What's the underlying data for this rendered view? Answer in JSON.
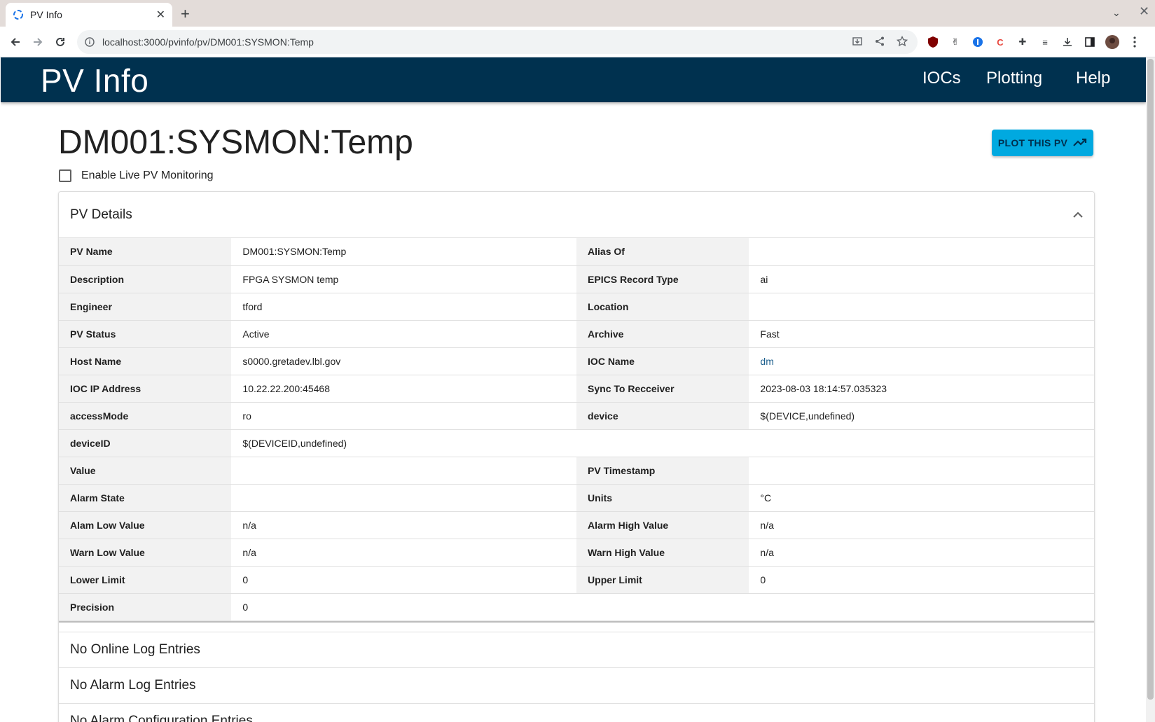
{
  "browser": {
    "tab_title": "PV Info",
    "url": "localhost:3000/pvinfo/pv/DM001:SYSMON:Temp",
    "favicon": "spinner-icon"
  },
  "app": {
    "brand": "PV Info",
    "nav": [
      "IOCs",
      "Plotting",
      "Help"
    ],
    "bg_color": "#00314f",
    "accent_color": "#00a9e0"
  },
  "page": {
    "pv_title": "DM001:SYSMON:Temp",
    "plot_button": "PLOT THIS PV",
    "monitor_label": "Enable Live PV Monitoring",
    "monitor_checked": false
  },
  "details": {
    "header": "PV Details",
    "rows": [
      {
        "l1": "PV Name",
        "v1": "DM001:SYSMON:Temp",
        "l2": "Alias Of",
        "v2": ""
      },
      {
        "l1": "Description",
        "v1": "FPGA SYSMON temp",
        "l2": "EPICS Record Type",
        "v2": "ai"
      },
      {
        "l1": "Engineer",
        "v1": "tford",
        "l2": "Location",
        "v2": ""
      },
      {
        "l1": "PV Status",
        "v1": "Active",
        "l2": "Archive",
        "v2": "Fast"
      },
      {
        "l1": "Host Name",
        "v1": "s0000.gretadev.lbl.gov",
        "l2": "IOC Name",
        "v2": "dm"
      },
      {
        "l1": "IOC IP Address",
        "v1": "10.22.22.200:45468",
        "l2": "Sync To Recceiver",
        "v2": "2023-08-03 18:14:57.035323"
      },
      {
        "l1": "accessMode",
        "v1": "ro",
        "l2": "device",
        "v2": "$(DEVICE,undefined)"
      },
      {
        "l1": "deviceID",
        "v1": "$(DEVICEID,undefined)"
      },
      {
        "l1": "Value",
        "v1": "",
        "l2": "PV Timestamp",
        "v2": ""
      },
      {
        "l1": "Alarm State",
        "v1": "",
        "l2": "Units",
        "v2": "°C"
      },
      {
        "l1": "Alam Low Value",
        "v1": "n/a",
        "l2": "Alarm High Value",
        "v2": "n/a"
      },
      {
        "l1": "Warn Low Value",
        "v1": "n/a",
        "l2": "Warn High Value",
        "v2": "n/a"
      },
      {
        "l1": "Lower Limit",
        "v1": "0",
        "l2": "Upper Limit",
        "v2": "0"
      },
      {
        "l1": "Precision",
        "v1": "0"
      }
    ]
  },
  "logs": {
    "online": "No Online Log Entries",
    "alarm": "No Alarm Log Entries",
    "alarm_config": "No Alarm Configuration Entries"
  }
}
